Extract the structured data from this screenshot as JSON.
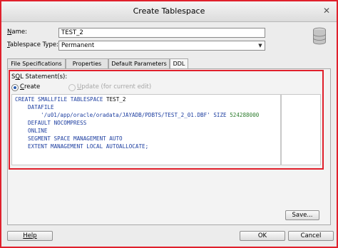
{
  "dialog": {
    "title": "Create Tablespace"
  },
  "form": {
    "name_label_prefix": "N",
    "name_label_rest": "ame:",
    "name_value": "TEST_2",
    "type_label_prefix": "T",
    "type_label_rest": "ablespace Type:",
    "type_value": "Permanent"
  },
  "tabs": [
    {
      "label": "File Specifications",
      "active": false
    },
    {
      "label": "Properties",
      "active": false
    },
    {
      "label": "Default Parameters",
      "active": false
    },
    {
      "label": "DDL",
      "active": true
    }
  ],
  "ddl": {
    "statements_label_prefix": "S",
    "statements_label_mid": "Q",
    "statements_label_rest": "L Statement(s):",
    "create_label_prefix": "C",
    "create_label_rest": "reate",
    "update_label_prefix": "U",
    "update_label_rest": "pdate (for current edit)",
    "create_selected": true,
    "code": {
      "line1": "CREATE SMALLFILE TABLESPACE ",
      "line1_name": "TEST_2",
      "line2": "DATAFILE",
      "line3_path": "'/u01/app/oracle/oradata/JAYADB/PDBTS/TEST_2_01.DBF'",
      "line3_size_kw": " SIZE ",
      "line3_size": "524288000",
      "line4": "DEFAULT NOCOMPRESS",
      "line5": "ONLINE",
      "line6": "SEGMENT SPACE MANAGEMENT AUTO",
      "line7": "EXTENT MANAGEMENT LOCAL AUTOALLOCATE;"
    }
  },
  "buttons": {
    "save": "Save...",
    "help": "Help",
    "ok": "OK",
    "cancel": "Cancel"
  },
  "colors": {
    "highlight_border": "#e0202c",
    "code_keyword": "#1d3ea0",
    "code_number": "#2e7d2e"
  },
  "icons": {
    "dialog_icon": "database-icon",
    "close": "close-icon"
  }
}
